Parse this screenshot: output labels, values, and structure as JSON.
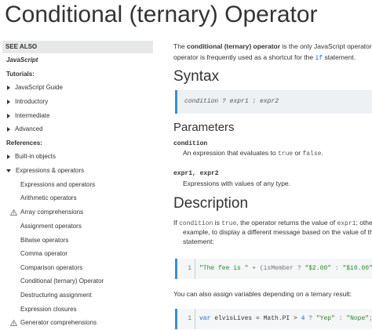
{
  "page": {
    "title": "Conditional (ternary) Operator"
  },
  "sidebar": {
    "see_also": "SEE ALSO",
    "javascript": "JavaScript",
    "tutorials_heading": "Tutorials:",
    "tutorials": [
      "JavaScript Guide",
      "Introductory",
      "Intermediate",
      "Advanced"
    ],
    "references_heading": "References:",
    "built_in": "Built-in objects",
    "expressions": "Expressions & operators",
    "expr_items": [
      "Expressions and operators",
      "Arithmetic operators",
      "Array comprehensions",
      "Assignment operators",
      "Bitwise operators",
      "Comma operator",
      "Comparison operators",
      "Conditional (ternary) Operator",
      "Destructuring assignment",
      "Expression closures",
      "Generator comprehensions"
    ]
  },
  "main": {
    "intro": {
      "l1_a": "The ",
      "l1_b": "conditional (ternary) operator",
      "l1_c": " is the only JavaScript operator",
      "l2_a": "operator is frequently used as a shortcut for the ",
      "l2_code": "if",
      "l2_b": " statement."
    },
    "syntax_heading": "Syntax",
    "syntax_code": "condition ? expr1 : expr2",
    "parameters_heading": "Parameters",
    "param1_name": "condition",
    "param1_desc_a": "An expression that evaluates to ",
    "param1_true": "true",
    "param1_or": " or ",
    "param1_false": "false",
    "param1_dot": ".",
    "param2_name": "expr1, expr2",
    "param2_desc": "Expressions with values of any type.",
    "description_heading": "Description",
    "desc_l1_a": "If ",
    "desc_l1_code1": "condition",
    "desc_l1_b": " is ",
    "desc_l1_code2": "true",
    "desc_l1_c": ", the operator returns the value of ",
    "desc_l1_code3": "expr1",
    "desc_l1_d": "; othe",
    "desc_l2": "example, to display a different message based on the value of the",
    "desc_l3": "statement:",
    "code1": {
      "line": "1",
      "s1": "\"The fee is \"",
      "p1": " + (isMember ? ",
      "s2": "\"$2.00\"",
      "p2": " : ",
      "s3": "\"$10.00\"",
      "p3": ")"
    },
    "assign_text": "You can also assign variables depending on a ternary result:",
    "code2": {
      "line": "1",
      "kw": "var",
      "p1": " elvisLives = Math.PI > ",
      "num": "4",
      "p2": " ? ",
      "s1": "\"Yep\"",
      "p3": " : ",
      "s2": "\"Nope\"",
      "p4": ";"
    }
  }
}
